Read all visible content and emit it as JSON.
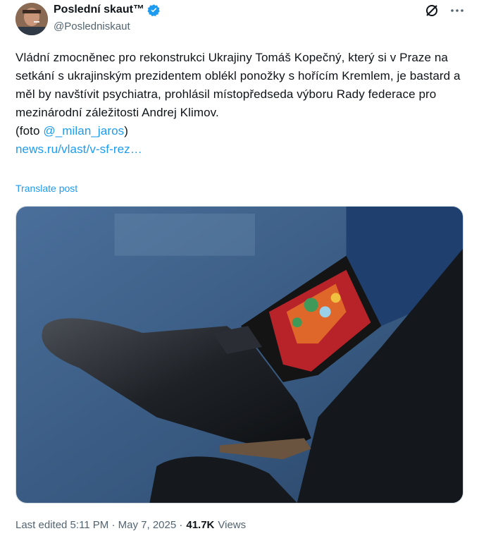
{
  "author": {
    "name": "Poslední skaut™",
    "handle": "@Posledniskaut"
  },
  "icons": {
    "verified": "verified-badge-icon",
    "grok": "grok-icon",
    "more": "more-dots-icon"
  },
  "post": {
    "text": "Vládní zmocněnec pro rekonstrukci Ukrajiny Tomáš Kopečný, který si v Praze na setkání s ukrajinským prezidentem oblékl ponožky s hořícím Kremlem, je bastard a měl by navštívit psychiatra, prohlásil místopředseda výboru Rady federace pro mezinárodní záležitosti Andrej Klimov.",
    "credit_prefix": "(foto ",
    "credit_mention": "@_milan_jaros",
    "credit_suffix": ")",
    "url": "news.ru/vlast/v-sf-rez…",
    "translate_label": "Translate post"
  },
  "meta": {
    "edited": "Last edited 5:11 PM · May 7, 2025 ·",
    "views_count": "41.7K",
    "views_label": "Views"
  },
  "colors": {
    "accent": "#1d9bf0",
    "secondary_text": "#536471",
    "primary_text": "#0f1419"
  }
}
